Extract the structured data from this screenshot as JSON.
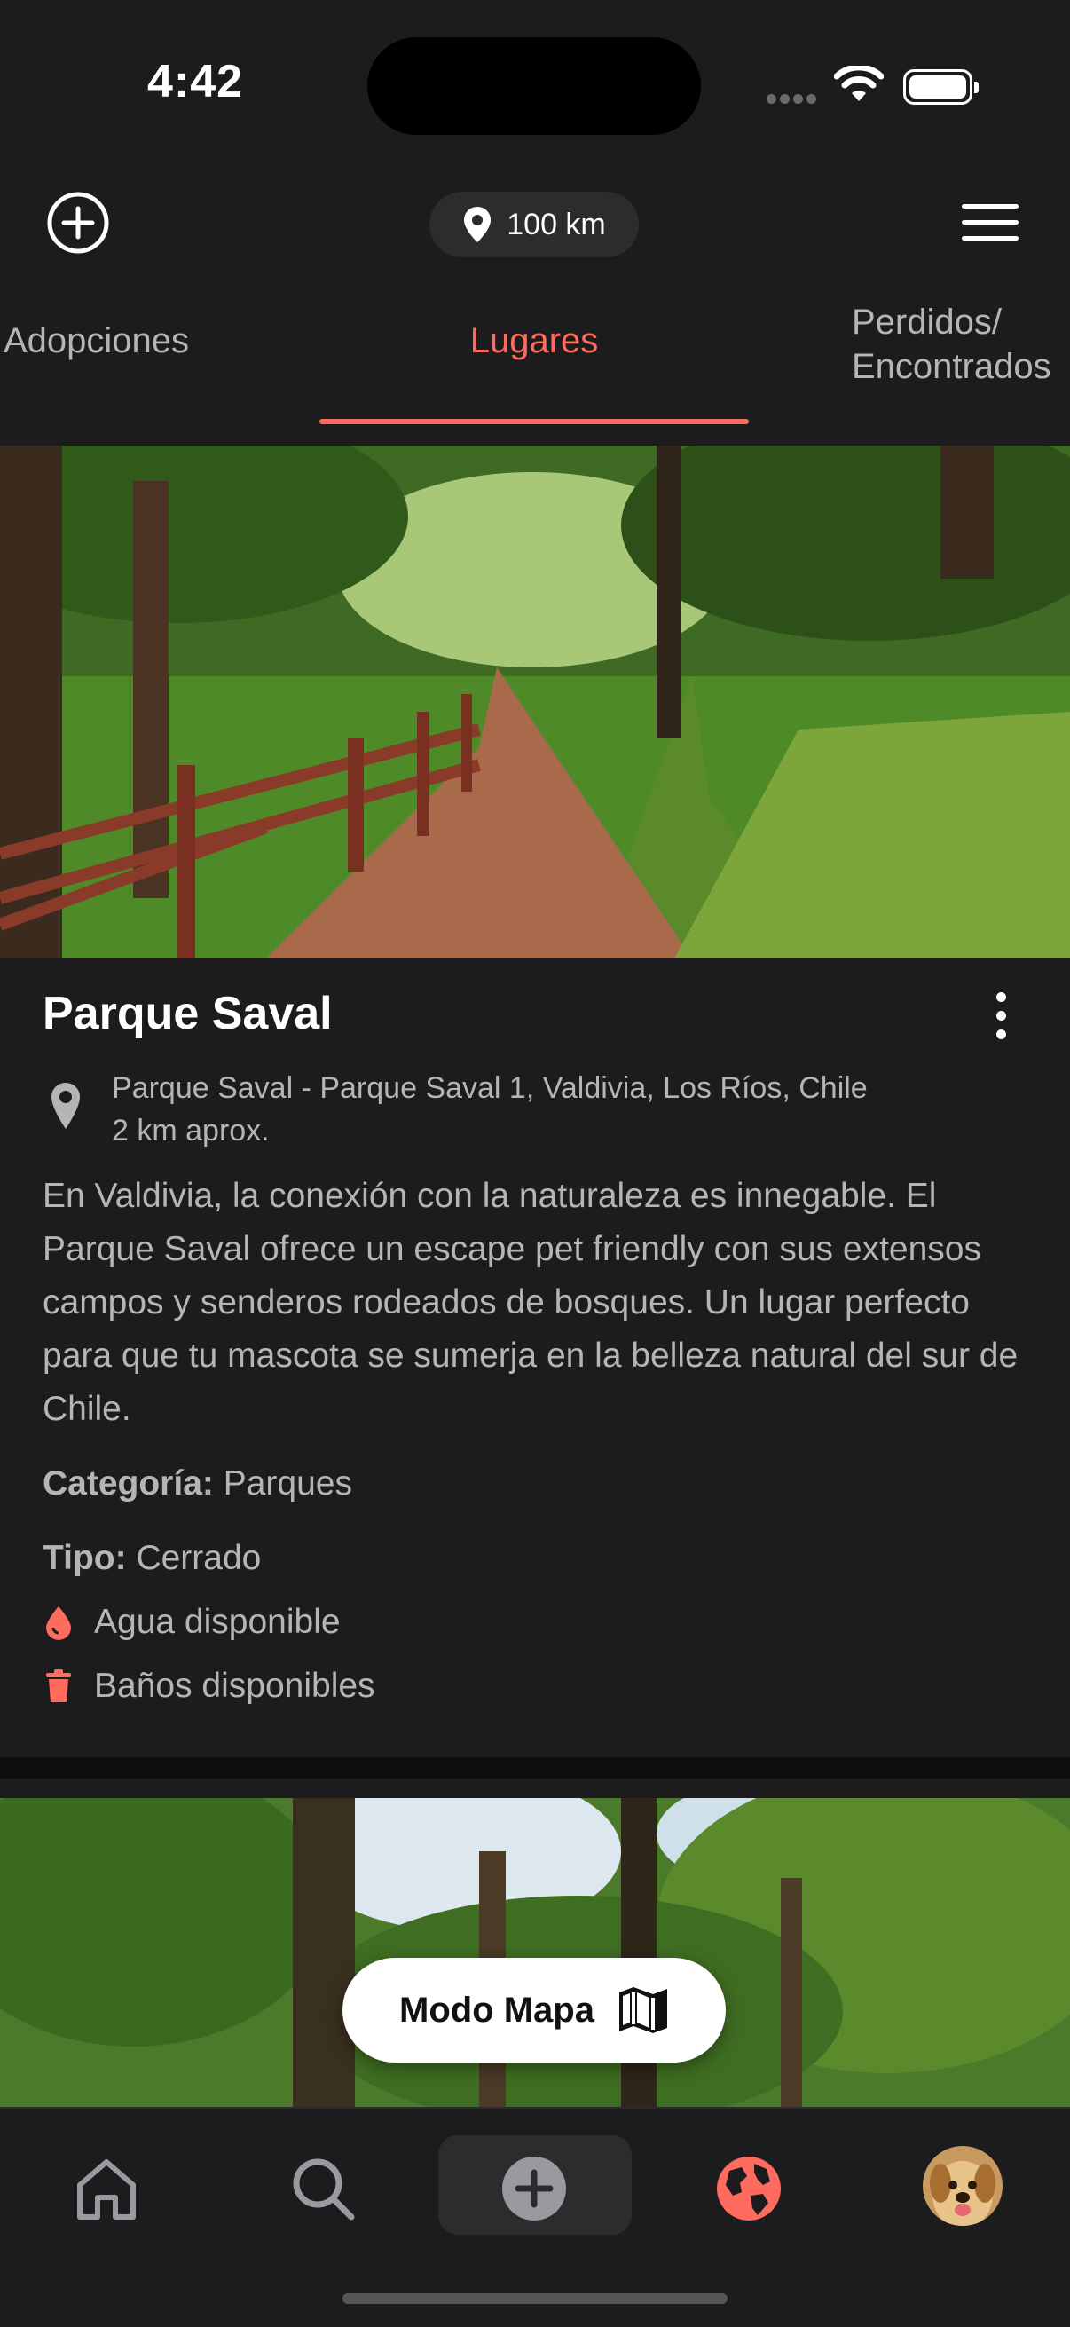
{
  "status_bar": {
    "time": "4:42"
  },
  "header": {
    "add_icon": "plus-circle-icon",
    "distance_label": "100 km",
    "menu_icon": "hamburger-icon"
  },
  "tabs": [
    {
      "label": "Adopciones",
      "active": false
    },
    {
      "label": "Lugares",
      "active": true
    },
    {
      "label": "Perdidos/\nEncontrados",
      "active": false
    }
  ],
  "places": [
    {
      "name": "Parque Saval",
      "address": "Parque Saval - Parque Saval 1, Valdivia, Los Ríos, Chile",
      "distance": "2 km aprox.",
      "description": "En Valdivia, la conexión con la naturaleza es innegable. El Parque Saval ofrece un escape pet friendly con sus extensos campos y senderos rodeados de bosques. Un lugar perfecto para que tu mascota se sumerja en la belleza natural del sur de Chile.",
      "category_label": "Categoría:",
      "category_value": "Parques",
      "type_label": "Tipo:",
      "type_value": "Cerrado",
      "features": [
        "Agua disponible",
        "Baños disponibles"
      ]
    }
  ],
  "map_button": {
    "label": "Modo Mapa"
  },
  "bottom_nav": [
    {
      "name": "home",
      "icon": "home-icon"
    },
    {
      "name": "search",
      "icon": "search-icon"
    },
    {
      "name": "add",
      "icon": "plus-circle-icon"
    },
    {
      "name": "explore",
      "icon": "globe-icon",
      "active": true
    },
    {
      "name": "profile",
      "icon": "avatar"
    }
  ],
  "colors": {
    "accent": "#ff6b5e",
    "background": "#1c1c1e",
    "muted_text": "#b5b5b8"
  }
}
